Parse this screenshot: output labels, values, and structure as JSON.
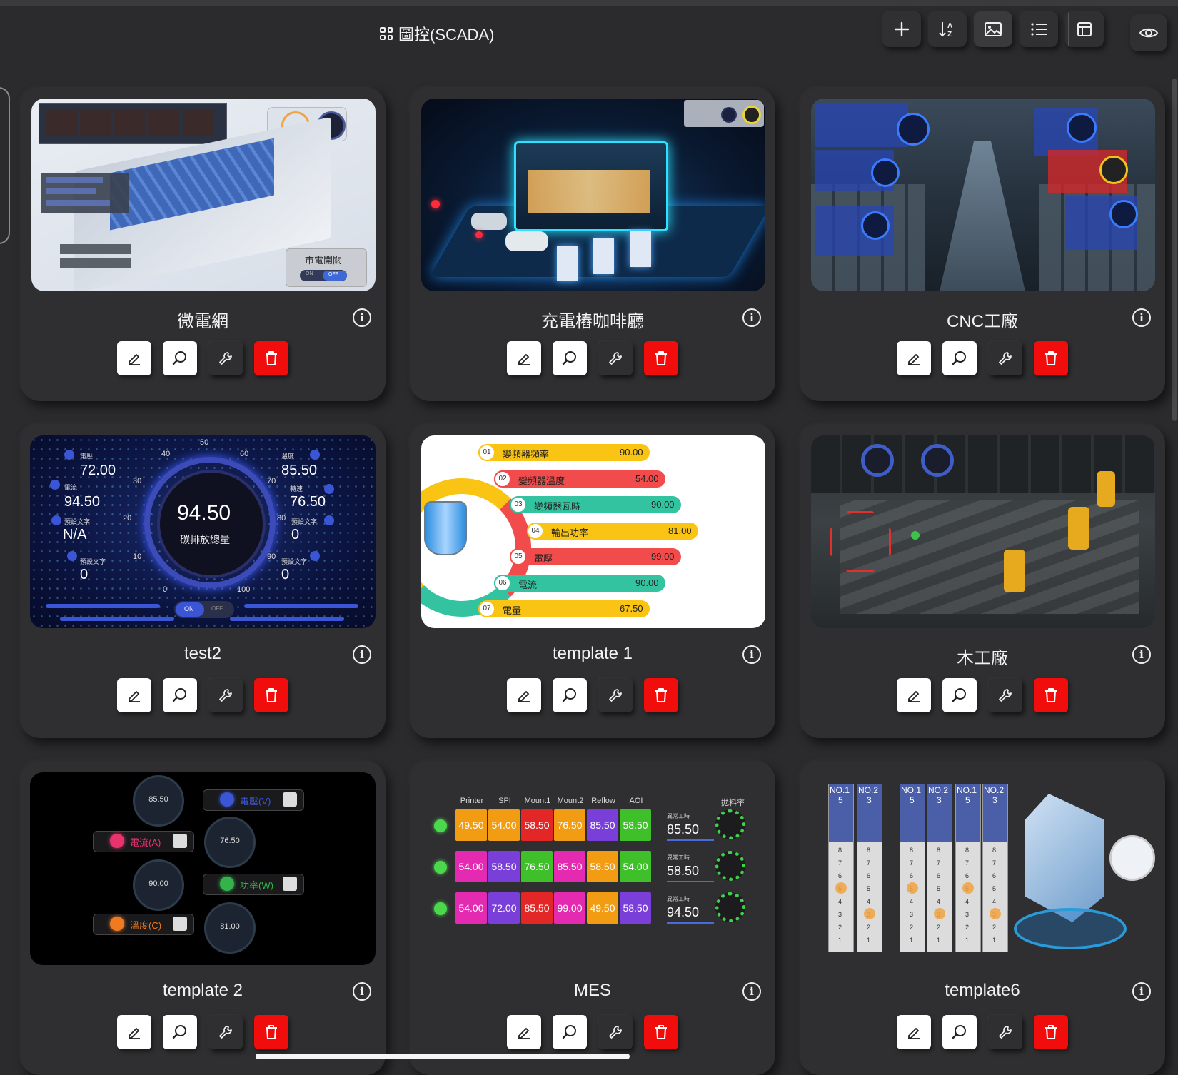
{
  "header": {
    "title": "圖控(SCADA)",
    "grid_icon": "grid-icon",
    "toolbar": [
      {
        "name": "add-button",
        "icon": "plus-icon"
      },
      {
        "name": "sort-button",
        "icon": "sort-az-icon"
      },
      {
        "name": "image-view-button",
        "icon": "image-icon",
        "active": true
      },
      {
        "name": "list-view-button",
        "icon": "list-icon"
      },
      {
        "name": "layout-view-button",
        "icon": "layout-icon"
      }
    ],
    "eye_icon": "eye-icon"
  },
  "actions": {
    "edit_icon": "pencil-icon",
    "preview_icon": "zoom-icon",
    "settings_icon": "wrench-icon",
    "delete_icon": "trash-icon"
  },
  "cards": [
    {
      "name": "微電網",
      "thumb": {
        "switch_label": "市電開關",
        "on": "ON",
        "off": "OFF"
      }
    },
    {
      "name": "充電樁咖啡廳",
      "thumb": {}
    },
    {
      "name": "CNC工廠",
      "thumb": {}
    },
    {
      "name": "test2",
      "thumb": {
        "center_value": "94.50",
        "center_label": "碳排放總量",
        "left": [
          {
            "label": "電壓",
            "value": "72.00"
          },
          {
            "label": "電流",
            "value": "94.50"
          },
          {
            "label": "預設文字",
            "value": "N/A"
          },
          {
            "label": "預設文字",
            "value": "0"
          }
        ],
        "right": [
          {
            "label": "溫度",
            "value": "85.50"
          },
          {
            "label": "轉速",
            "value": "76.50"
          },
          {
            "label": "預設文字",
            "value": "0"
          },
          {
            "label": "預設文字",
            "value": "0"
          }
        ],
        "ticks": [
          "0",
          "10",
          "20",
          "30",
          "40",
          "50",
          "60",
          "70",
          "80",
          "90",
          "100"
        ],
        "switch_on": "ON",
        "switch_off": "OFF"
      }
    },
    {
      "name": "template 1",
      "thumb": {
        "rows": [
          {
            "no": "01",
            "label": "變頻器頻率",
            "value": "90.00",
            "color": "#f9c413"
          },
          {
            "no": "02",
            "label": "變頻器溫度",
            "value": "54.00",
            "color": "#f24b4b"
          },
          {
            "no": "03",
            "label": "變頻器瓦時",
            "value": "90.00",
            "color": "#34c3a0"
          },
          {
            "no": "04",
            "label": "輸出功率",
            "value": "81.00",
            "color": "#f9c413"
          },
          {
            "no": "05",
            "label": "電壓",
            "value": "99.00",
            "color": "#f24b4b"
          },
          {
            "no": "06",
            "label": "電流",
            "value": "90.00",
            "color": "#34c3a0"
          },
          {
            "no": "07",
            "label": "電量",
            "value": "67.50",
            "color": "#f9c413"
          }
        ]
      }
    },
    {
      "name": "木工廠",
      "thumb": {}
    },
    {
      "name": "template 2",
      "thumb": {
        "gauges": [
          "85.50",
          "76.50",
          "90.00",
          "81.00"
        ],
        "pills": [
          {
            "label": "電壓(V)",
            "dot": "#3a55d6"
          },
          {
            "label": "電流(A)",
            "dot": "#e8336d"
          },
          {
            "label": "功率(W)",
            "dot": "#34b34a"
          },
          {
            "label": "溫度(C)",
            "dot": "#f07a22"
          }
        ]
      }
    },
    {
      "name": "MES",
      "thumb": {
        "columns": [
          "Printer",
          "SPI",
          "Mount1",
          "Mount2",
          "Reflow",
          "AOI"
        ],
        "rate_label": "拋料率",
        "side_label": "異常工時",
        "rows": [
          {
            "cells": [
              [
                "49.50",
                "#f29c13"
              ],
              [
                "54.00",
                "#f29c13"
              ],
              [
                "58.50",
                "#e32626"
              ],
              [
                "76.50",
                "#f29c13"
              ],
              [
                "85.50",
                "#7a3fd9"
              ],
              [
                "58.50",
                "#3fbf2a"
              ]
            ],
            "side": "85.50"
          },
          {
            "cells": [
              [
                "54.00",
                "#e32ab0"
              ],
              [
                "58.50",
                "#7a3fd9"
              ],
              [
                "76.50",
                "#3fbf2a"
              ],
              [
                "85.50",
                "#e32ab0"
              ],
              [
                "58.50",
                "#f29c13"
              ],
              [
                "54.00",
                "#3fbf2a"
              ]
            ],
            "side": "58.50"
          },
          {
            "cells": [
              [
                "54.00",
                "#e32ab0"
              ],
              [
                "72.00",
                "#7a3fd9"
              ],
              [
                "85.50",
                "#e32626"
              ],
              [
                "99.00",
                "#e32ab0"
              ],
              [
                "49.50",
                "#f29c13"
              ],
              [
                "58.50",
                "#7a3fd9"
              ]
            ],
            "side": "94.50"
          }
        ]
      }
    },
    {
      "name": "template6",
      "thumb": {
        "towers": [
          {
            "top": "NO.1",
            "num": "5"
          },
          {
            "top": "NO.2",
            "num": "3"
          },
          {
            "top": "NO.1",
            "num": "5"
          },
          {
            "top": "NO.2",
            "num": "3"
          },
          {
            "top": "NO.1",
            "num": "5"
          },
          {
            "top": "NO.2",
            "num": "3"
          }
        ],
        "levels": [
          "8",
          "7",
          "6",
          "5",
          "4",
          "3",
          "2",
          "1"
        ]
      }
    }
  ]
}
